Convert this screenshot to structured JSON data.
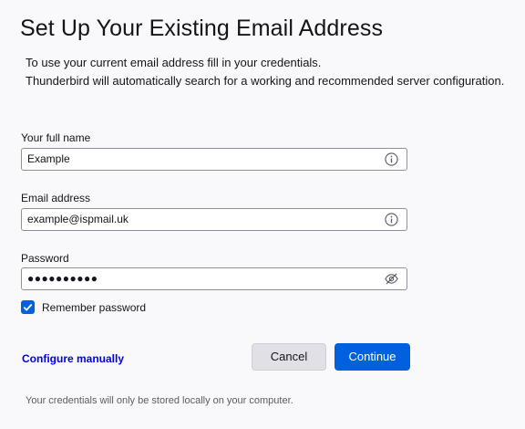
{
  "page": {
    "title": "Set Up Your Existing Email Address",
    "description_line1": "To use your current email address fill in your credentials.",
    "description_line2": "Thunderbird will automatically search for a working and recommended server configuration."
  },
  "form": {
    "full_name": {
      "label": "Your full name",
      "value": "Example",
      "icon": "info-icon"
    },
    "email": {
      "label": "Email address",
      "value": "example@ispmail.uk",
      "icon": "info-icon"
    },
    "password": {
      "label": "Password",
      "value": "●●●●●●●●●●",
      "icon": "eye-slash-icon"
    },
    "remember": {
      "label": "Remember password",
      "checked": true
    }
  },
  "actions": {
    "configure_manually": "Configure manually",
    "cancel": "Cancel",
    "continue": "Continue"
  },
  "footer": {
    "note": "Your credentials will only be stored locally on your computer."
  },
  "colors": {
    "accent": "#0061e0",
    "link": "#0000ee",
    "background": "#f9f9fb"
  }
}
